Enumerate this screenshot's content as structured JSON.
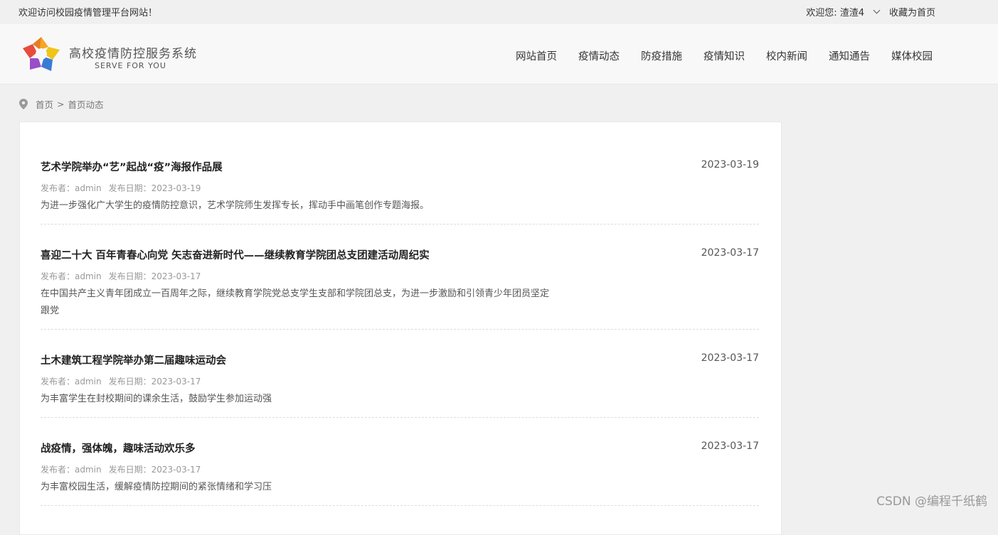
{
  "topbar": {
    "welcome": "欢迎访问校园疫情管理平台网站！",
    "user": "欢迎您: 渣渣4",
    "favorite": "收藏为首页"
  },
  "brand": {
    "title": "高校疫情防控服务系统",
    "subtitle": "SERVE FOR YOU"
  },
  "nav": [
    "网站首页",
    "疫情动态",
    "防疫措施",
    "疫情知识",
    "校内新闻",
    "通知通告",
    "媒体校园"
  ],
  "breadcrumb": {
    "home": "首页",
    "separator": ">",
    "current": "首页动态"
  },
  "articles": [
    {
      "title": "艺术学院举办“艺”起战“疫”海报作品展",
      "date": "2023-03-19",
      "author": "发布者：admin",
      "pubdate": "发布日期：2023-03-19",
      "summary": "为进一步强化广大学生的疫情防控意识，艺术学院师生发挥专长，挥动手中画笔创作专题海报。"
    },
    {
      "title": "喜迎二十大 百年青春心向党 矢志奋进新时代——继续教育学院团总支团建活动周纪实",
      "date": "2023-03-17",
      "author": "发布者：admin",
      "pubdate": "发布日期：2023-03-17",
      "summary": "在中国共产主义青年团成立一百周年之际，继续教育学院党总支学生支部和学院团总支，为进一步激励和引领青少年团员坚定跟党"
    },
    {
      "title": "土木建筑工程学院举办第二届趣味运动会",
      "date": "2023-03-17",
      "author": "发布者：admin",
      "pubdate": "发布日期：2023-03-17",
      "summary": "为丰富学生在封校期间的课余生活，鼓励学生参加运动强"
    },
    {
      "title": "战疫情，强体魄，趣味活动欢乐多",
      "date": "2023-03-17",
      "author": "发布者：admin",
      "pubdate": "发布日期：2023-03-17",
      "summary": "为丰富校园生活，缓解疫情防控期间的紧张情绪和学习压"
    }
  ],
  "watermark": "CSDN @编程千纸鹤",
  "colors": {
    "background": "#f0f0f0",
    "header": "#f8f8f8",
    "panel": "#ffffff",
    "text": "#333333",
    "muted": "#999999"
  }
}
